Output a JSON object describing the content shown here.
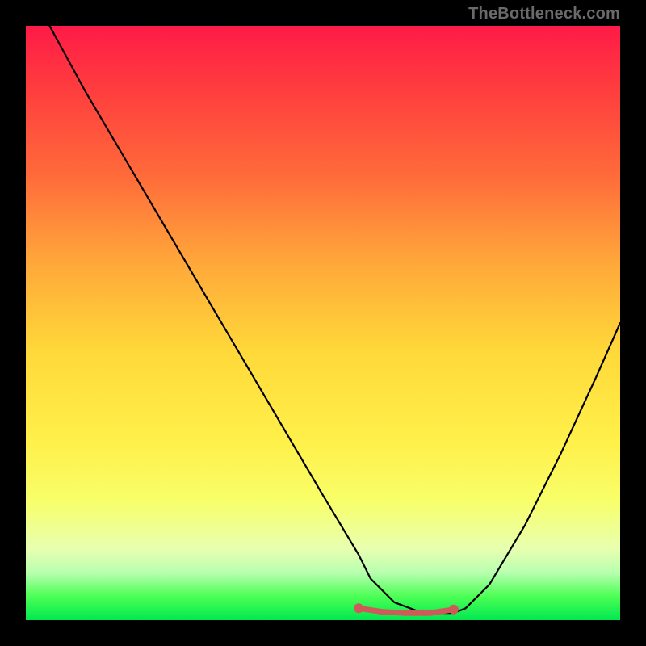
{
  "watermark": "TheBottleneck.com",
  "chart_data": {
    "type": "line",
    "title": "",
    "xlabel": "",
    "ylabel": "",
    "xlim": [
      0,
      100
    ],
    "ylim": [
      0,
      100
    ],
    "grid": false,
    "legend": false,
    "notes": "Background is a vertical red→yellow→green heat gradient. No axis ticks or numeric labels are shown. Curve values are estimated from pixel positions (y measured from bottom of plot area).",
    "series": [
      {
        "name": "bottleneck-curve",
        "color": "#000000",
        "x": [
          4,
          10,
          20,
          30,
          40,
          50,
          56,
          58,
          62,
          66,
          70,
          72,
          74,
          78,
          84,
          90,
          96,
          100
        ],
        "y": [
          100,
          89,
          72,
          55,
          38,
          21,
          11,
          7,
          3,
          1.5,
          1.2,
          1.2,
          2,
          6,
          16,
          28,
          41,
          50
        ]
      },
      {
        "name": "optimal-plateau-marker",
        "color": "#cf5a5a",
        "x": [
          56,
          60,
          64,
          68,
          72
        ],
        "y": [
          2.0,
          1.4,
          1.2,
          1.2,
          1.8
        ]
      }
    ],
    "markers": [
      {
        "name": "plateau-left-dot",
        "x": 56,
        "y": 2.0,
        "color": "#cf5a5a"
      },
      {
        "name": "plateau-right-dot",
        "x": 72,
        "y": 1.8,
        "color": "#cf5a5a"
      }
    ]
  }
}
